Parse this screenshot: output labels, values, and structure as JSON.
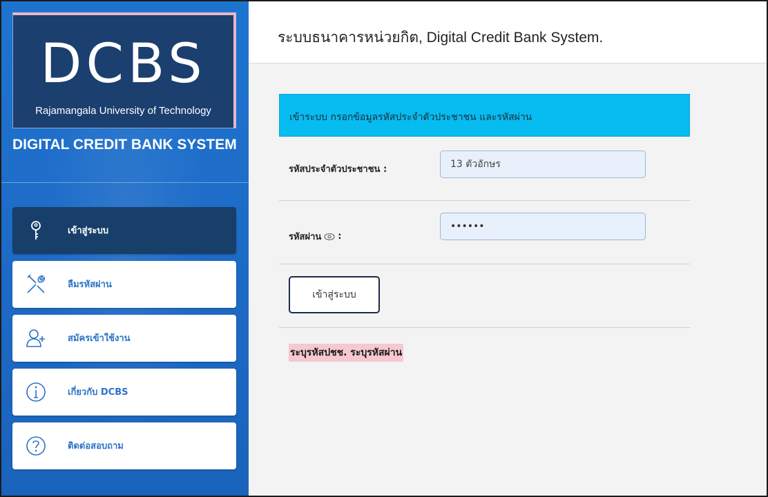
{
  "logo": {
    "main_text": "DCBS",
    "sub_text": "Rajamangala University of Technology"
  },
  "sidebar": {
    "system_name": "DIGITAL CREDIT BANK SYSTEM",
    "items": [
      {
        "label": "เข้าสู่ระบบ",
        "icon": "key-icon",
        "active": true
      },
      {
        "label": "ลืมรหัสผ่าน",
        "icon": "tools-icon",
        "active": false
      },
      {
        "label": "สมัครเข้าใช้งาน",
        "icon": "add-user-icon",
        "active": false
      },
      {
        "label": "เกี่ยวกับ DCBS",
        "icon": "info-icon",
        "active": false
      },
      {
        "label": "ติดต่อสอบถาม",
        "icon": "help-icon",
        "active": false
      }
    ],
    "accent_color": "#1d74cf",
    "active_color": "#173f6a"
  },
  "header": {
    "title": "ระบบธนาคารหน่วยกิต, Digital Credit Bank System."
  },
  "login": {
    "banner_text": "เข้าระบบ กรอกข้อมูลรหัสประจำตัวประชาชน และรหัสผ่าน",
    "banner_color": "#06bcf0",
    "id_label": "รหัสประจำตัวประชาชน :",
    "id_placeholder": "13 ตัวอักษร",
    "id_value": "",
    "password_label": "รหัสผ่าน",
    "password_label_suffix": ":",
    "password_value": "••••••",
    "submit_label": "เข้าสู่ระบบ",
    "error_text": "ระบุรหัสปชช. ระบุรหัสผ่าน",
    "error_color": "#f6c8d0"
  }
}
